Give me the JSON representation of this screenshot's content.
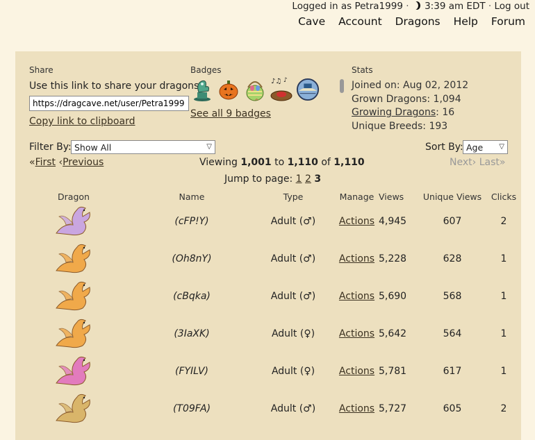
{
  "topbar": {
    "logged_in": "Logged in as Petra1999",
    "time": "3:39 am EDT",
    "logout": "Log out"
  },
  "nav": [
    "Cave",
    "Account",
    "Dragons",
    "Help",
    "Forum"
  ],
  "share": {
    "heading": "Share",
    "text": "Use this link to share your dragons:",
    "url": "https://dragcave.net/user/Petra1999",
    "copy": "Copy link to clipboard"
  },
  "badges": {
    "heading": "Badges",
    "items": [
      "dragon-statue-badge",
      "jack-o-lantern-badge",
      "easter-basket-badge",
      "music-nest-badge",
      "globe-badge"
    ],
    "see_all": "See all 9 badges"
  },
  "stats": {
    "heading": "Stats",
    "joined_label": "Joined on:",
    "joined_value": "Aug 02, 2012",
    "grown_label": "Grown Dragons:",
    "grown_value": "1,094",
    "growing_label": "Growing Dragons",
    "growing_value": ": 16",
    "unique_label": "Unique Breeds:",
    "unique_value": "193"
  },
  "filter": {
    "label": "Filter By:",
    "value": "Show All"
  },
  "sort": {
    "label": "Sort By:",
    "value": "Age"
  },
  "pager": {
    "first": "First",
    "previous": "Previous",
    "viewing_prefix": "Viewing",
    "from": "1,001",
    "to_word": "to",
    "to": "1,110",
    "of_word": "of",
    "total": "1,110",
    "next": "Next",
    "last": "Last",
    "jump_label": "Jump to page:",
    "pages": [
      "1",
      "2"
    ],
    "current": "3"
  },
  "table": {
    "headers": [
      "Dragon",
      "Name",
      "Type",
      "Manage",
      "Views",
      "Unique Views",
      "Clicks"
    ],
    "rows": [
      {
        "name": "(cFP!Y)",
        "type": "Adult (♂)",
        "manage": "Actions",
        "views": "4,945",
        "unique": "607",
        "clicks": "2",
        "color": "#c9a6e0"
      },
      {
        "name": "(Oh8nY)",
        "type": "Adult (♂)",
        "manage": "Actions",
        "views": "5,228",
        "unique": "628",
        "clicks": "1",
        "color": "#f0a94a"
      },
      {
        "name": "(cBqka)",
        "type": "Adult (♂)",
        "manage": "Actions",
        "views": "5,690",
        "unique": "568",
        "clicks": "1",
        "color": "#f0a94a"
      },
      {
        "name": "(3IaXK)",
        "type": "Adult (♀)",
        "manage": "Actions",
        "views": "5,642",
        "unique": "564",
        "clicks": "1",
        "color": "#f0a94a"
      },
      {
        "name": "(FYILV)",
        "type": "Adult (♀)",
        "manage": "Actions",
        "views": "5,781",
        "unique": "617",
        "clicks": "1",
        "color": "#e27bbd"
      },
      {
        "name": "(T09FA)",
        "type": "Adult (♂)",
        "manage": "Actions",
        "views": "5,727",
        "unique": "605",
        "clicks": "2",
        "color": "#d9b56a"
      }
    ]
  },
  "colors": {
    "background": "#fbf4e2",
    "panel": "#ede0bf",
    "link": "#3b3120"
  }
}
